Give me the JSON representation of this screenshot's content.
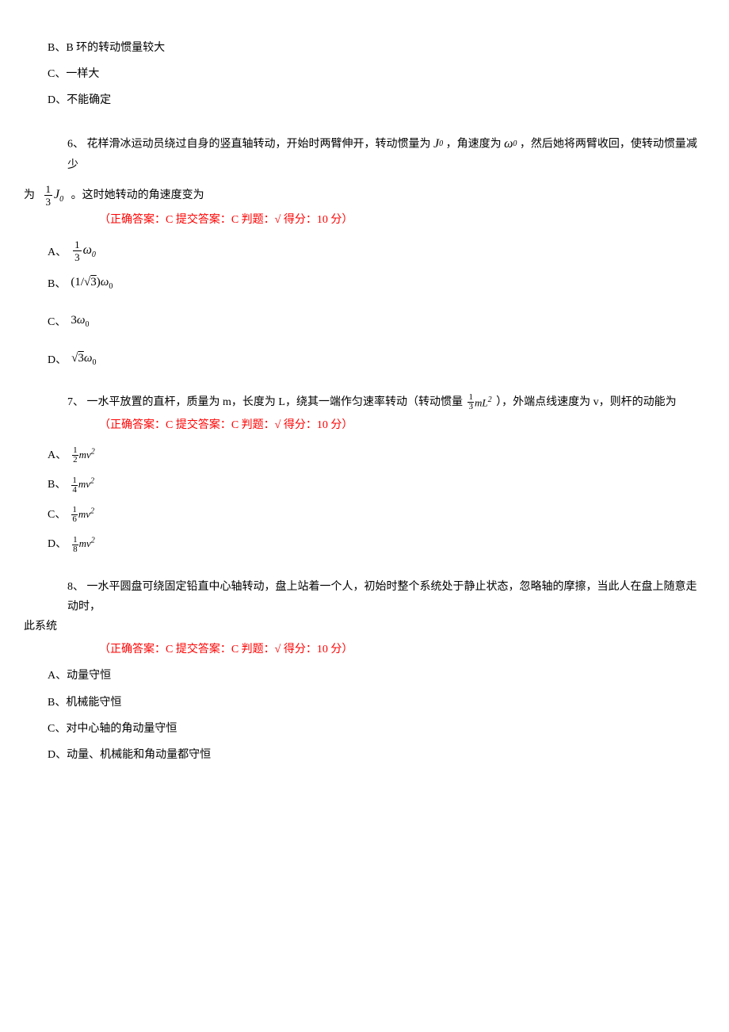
{
  "options_pre": {
    "B": "B、B 环的转动惯量较大",
    "C": "C、一样大",
    "D": "D、不能确定"
  },
  "q6": {
    "num": "6、",
    "text_before_J0": "花样滑冰运动员绕过自身的竖直轴转动，开始时两臂伸开，转动惯量为",
    "text_between": "，角速度为",
    "text_after_w0": "，然后她将两臂收回，使转动惯量减少",
    "text_line2_prefix": "为",
    "text_line2_suffix": "。这时她转动的角速度变为",
    "answer": "（正确答案：C  提交答案：C  判题：√  得分：10 分）",
    "options": {
      "A": "A、",
      "B": "B、",
      "C": "C、",
      "D": "D、"
    }
  },
  "q7": {
    "num": "7、",
    "text_before": "一水平放置的直杆，质量为 m，长度为 L，绕其一端作匀速率转动（转动惯量",
    "text_after": "），外端点线速度为 v，则杆的动能为",
    "answer": "（正确答案：C  提交答案：C  判题：√  得分：10 分）",
    "options": {
      "A": "A、",
      "B": "B、",
      "C": "C、",
      "D": "D、"
    }
  },
  "q8": {
    "num": "8、",
    "text_line1": "一水平圆盘可绕固定铅直中心轴转动，盘上站着一个人，初始时整个系统处于静止状态，忽略轴的摩擦，当此人在盘上随意走动时，",
    "text_line2": "此系统",
    "answer": "（正确答案：C  提交答案：C  判题：√  得分：10 分）",
    "options": {
      "A": "A、动量守恒",
      "B": "B、机械能守恒",
      "C": "C、对中心轴的角动量守恒",
      "D": "D、动量、机械能和角动量都守恒"
    }
  }
}
